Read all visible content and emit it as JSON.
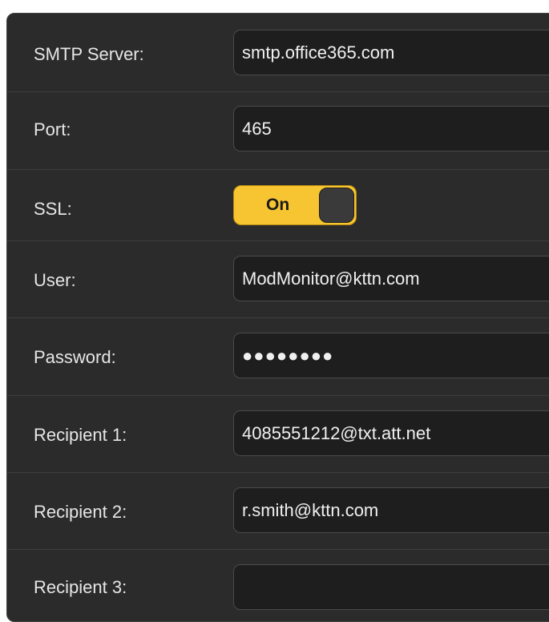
{
  "form": {
    "smtp_server": {
      "label": "SMTP Server:",
      "value": "smtp.office365.com"
    },
    "port": {
      "label": "Port:",
      "value": "465"
    },
    "ssl": {
      "label": "SSL:",
      "state": "On"
    },
    "user": {
      "label": "User:",
      "value": "ModMonitor@kttn.com"
    },
    "password": {
      "label": "Password:",
      "value": "●●●●●●●●"
    },
    "recipient_1": {
      "label": "Recipient 1:",
      "value": "4085551212@txt.att.net"
    },
    "recipient_2": {
      "label": "Recipient 2:",
      "value": "r.smith@kttn.com"
    },
    "recipient_3": {
      "label": "Recipient 3:",
      "value": ""
    }
  },
  "colors": {
    "panel_bg": "#2b2b2b",
    "field_bg": "#1e1e1e",
    "toggle_on": "#f7c531"
  }
}
